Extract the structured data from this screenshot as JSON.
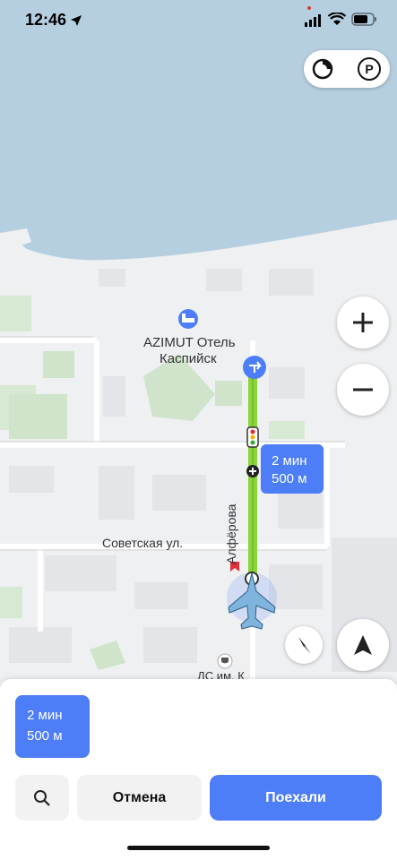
{
  "status_bar": {
    "time": "12:46"
  },
  "map": {
    "hotel_label_line1": "AZIMUT Отель",
    "hotel_label_line2": "Каспийск",
    "street_label": "Советская ул.",
    "street_vertical_label": "Алфёрова",
    "bottom_label": "ДС им. К",
    "eta_time": "2 мин",
    "eta_distance": "500 м",
    "route_color": "#8bd43a",
    "water_color": "#b6cfe0",
    "accent_color": "#4d7ef7"
  },
  "controls": {
    "zoom_in_icon": "plus-icon",
    "zoom_out_icon": "minus-icon",
    "compass_icon": "compass-icon",
    "locate_icon": "navigation-arrow-icon",
    "layers_icon": "layers-icon",
    "parking_label": "P"
  },
  "sheet": {
    "route_time": "2 мин",
    "route_distance": "500 м",
    "cancel_label": "Отмена",
    "go_label": "Поехали"
  }
}
